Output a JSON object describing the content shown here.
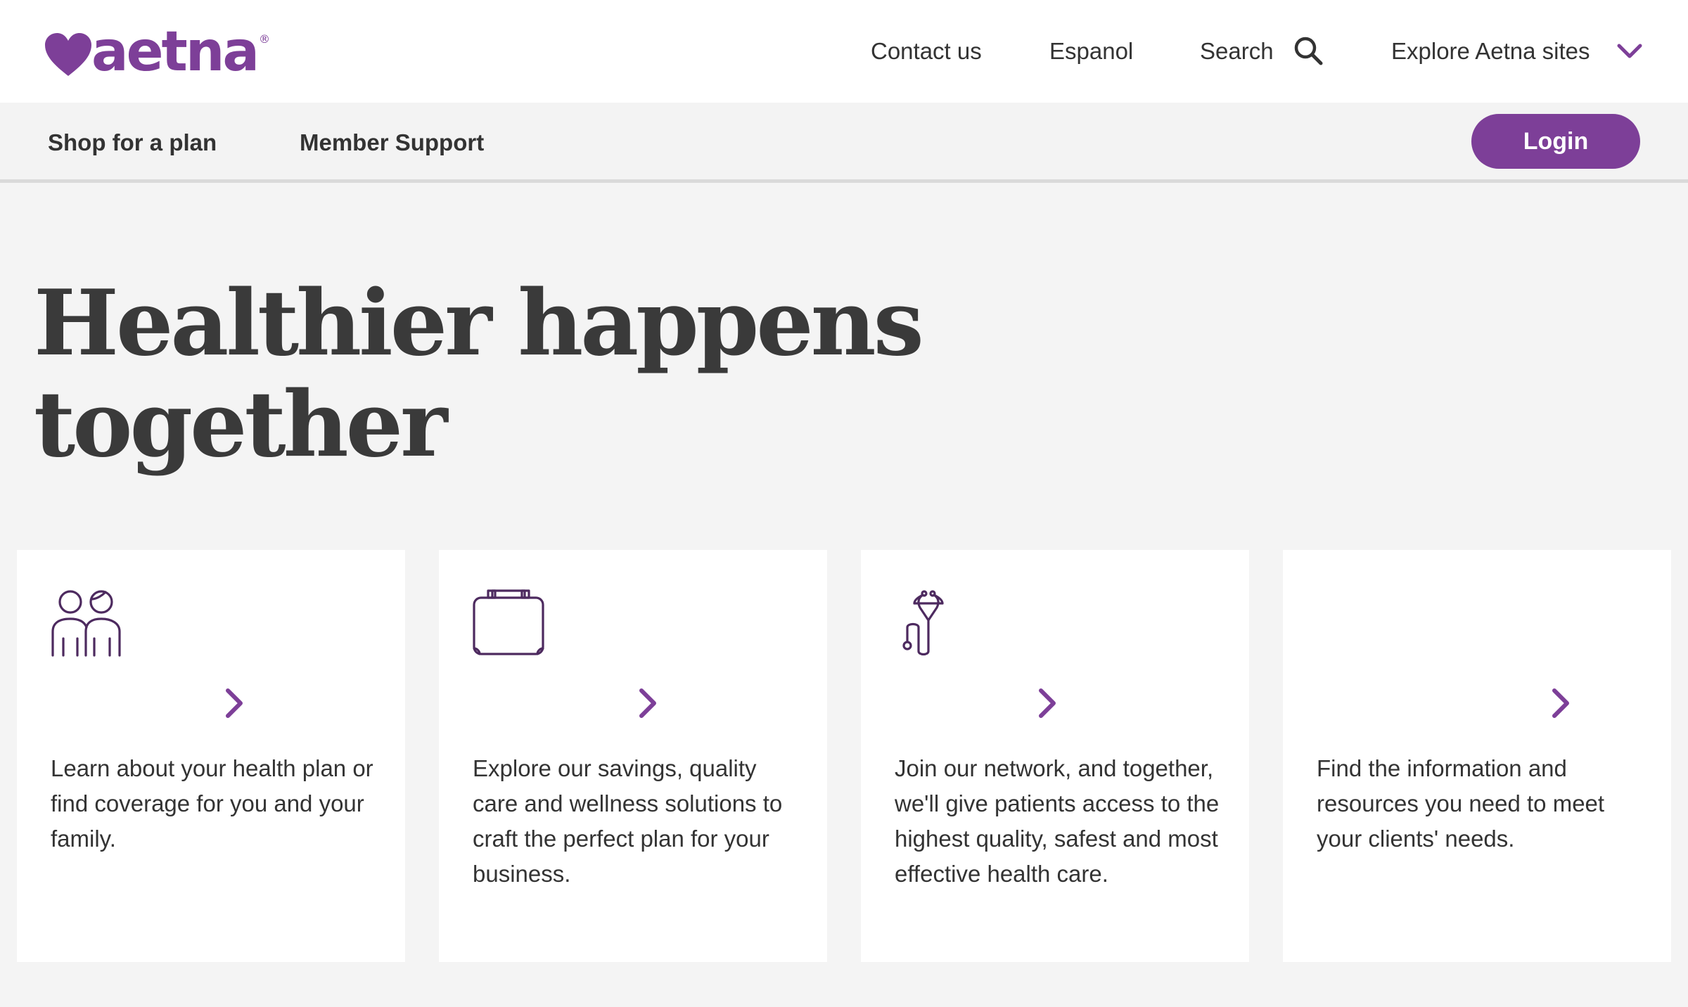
{
  "colors": {
    "brand_purple": "#7d3f98",
    "text_dark": "#333333",
    "heading": "#3a3a3a",
    "nav_bg": "#f3f3f3",
    "page_bg": "#f4f4f4",
    "card_bg": "#ffffff"
  },
  "brand": {
    "logo_text": "aetna",
    "registered_mark": "®"
  },
  "utility_nav": {
    "contact": "Contact us",
    "espanol": "Espanol",
    "search": "Search",
    "search_icon": "search-icon",
    "explore": "Explore Aetna sites",
    "explore_icon": "chevron-down-icon"
  },
  "main_nav": {
    "shop": "Shop for a plan",
    "member_support": "Member Support",
    "login": "Login"
  },
  "hero": {
    "title_line1": "Healthier happens",
    "title_line2": "together"
  },
  "cards": [
    {
      "icon": "people-icon",
      "text": "Learn about your health plan or find coverage for you and your family."
    },
    {
      "icon": "briefcase-icon",
      "text": "Explore our savings, quality care and wellness solutions to craft the perfect plan for your business."
    },
    {
      "icon": "stethoscope-icon",
      "text": "Join our network, and together, we'll give patients access to the highest quality, safest and most effective health care."
    },
    {
      "icon": "",
      "text": "Find the information and resources you need to meet your clients' needs."
    }
  ]
}
